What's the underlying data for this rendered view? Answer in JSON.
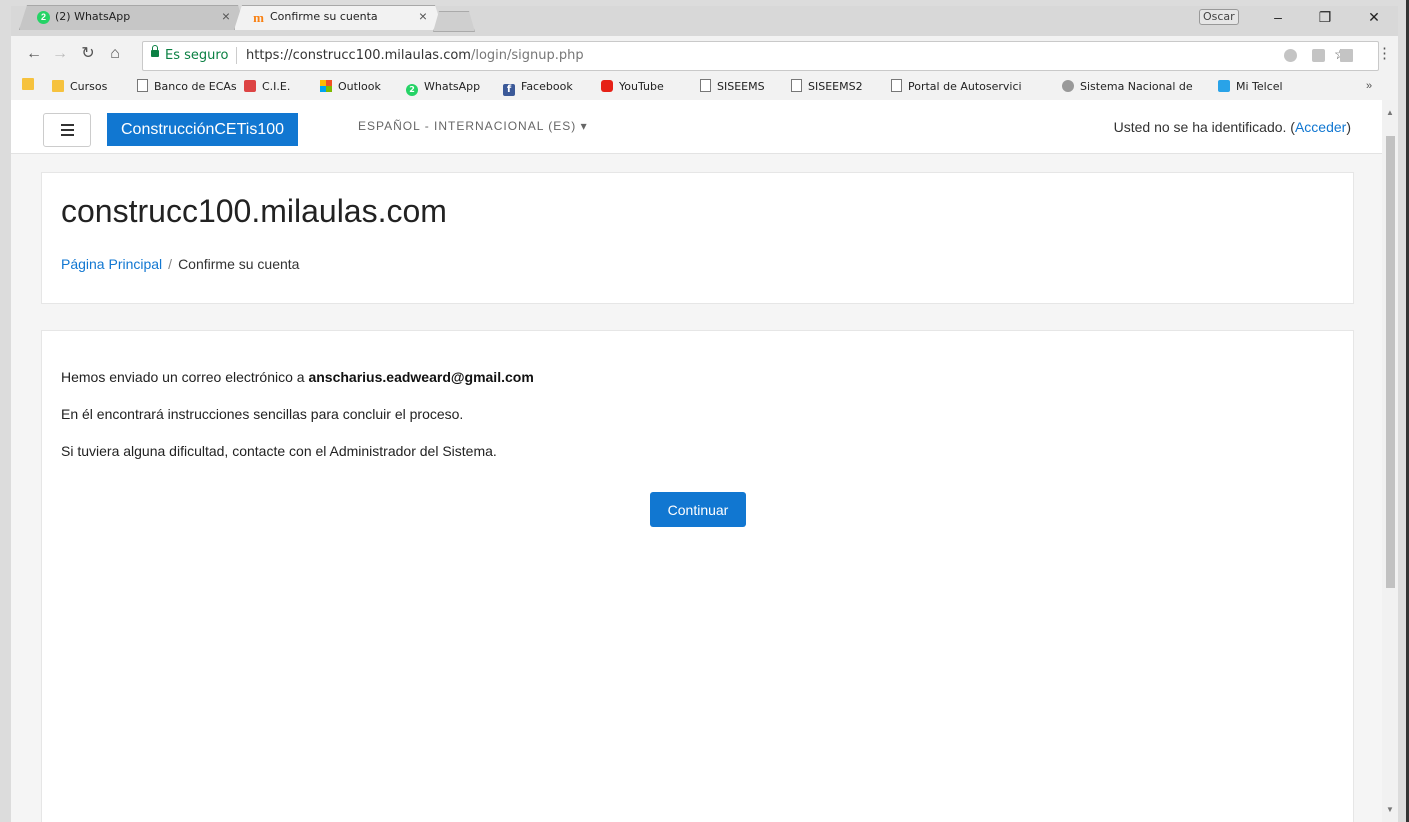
{
  "browser": {
    "tabs": [
      {
        "title": "(2) WhatsApp",
        "favicon": "whatsapp-icon",
        "badge": "2"
      },
      {
        "title": "Confirme su cuenta",
        "favicon": "moodle-icon",
        "badge": "m"
      }
    ],
    "profile_name": "Oscar",
    "secure_label": "Es seguro",
    "url_host": "https://construcc100.milaulas.com",
    "url_path": "/login/signup.php",
    "bookmarks": [
      {
        "label": "",
        "icon": "apps-icon"
      },
      {
        "label": "Cursos",
        "icon": "folder-icon"
      },
      {
        "label": "Banco de ECAs",
        "icon": "page-icon"
      },
      {
        "label": "C.I.E.",
        "icon": "cie-icon"
      },
      {
        "label": "Outlook",
        "icon": "outlook-icon"
      },
      {
        "label": "WhatsApp",
        "icon": "whatsapp-icon"
      },
      {
        "label": "Facebook",
        "icon": "facebook-icon"
      },
      {
        "label": "YouTube",
        "icon": "youtube-icon"
      },
      {
        "label": "SISEEMS",
        "icon": "page-icon"
      },
      {
        "label": "SISEEMS2",
        "icon": "page-icon"
      },
      {
        "label": "Portal de Autoservici",
        "icon": "page-icon"
      },
      {
        "label": "Sistema Nacional de",
        "icon": "globe-icon"
      },
      {
        "label": "Mi Telcel",
        "icon": "telcel-icon"
      }
    ],
    "more_bookmarks": "»"
  },
  "navbar": {
    "brand": "ConstrucciónCETis100",
    "language": "ESPAÑOL - INTERNACIONAL (ES)",
    "login_text": "Usted no se ha identificado. (",
    "login_link": "Acceder",
    "login_close": ")"
  },
  "header": {
    "site_title": "construcc100.milaulas.com",
    "breadcrumb_home": "Página Principal",
    "breadcrumb_divider": "/",
    "breadcrumb_current": "Confirme su cuenta"
  },
  "main": {
    "line1_prefix": "Hemos enviado un correo electrónico a ",
    "email": "anscharius.eadweard@gmail.com",
    "line2": "En él encontrará instrucciones sencillas para concluir el proceso.",
    "line3": "Si tuviera alguna dificultad, contacte con el Administrador del Sistema.",
    "continue_label": "Continuar"
  },
  "colors": {
    "accent": "#1177d1",
    "secure_green": "#0b8043"
  }
}
